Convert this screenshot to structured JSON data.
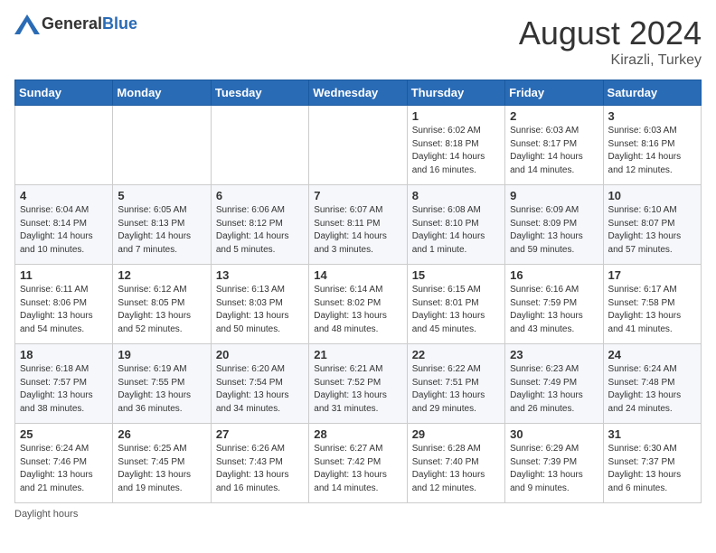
{
  "header": {
    "logo_general": "General",
    "logo_blue": "Blue",
    "month_year": "August 2024",
    "location": "Kirazli, Turkey"
  },
  "days_of_week": [
    "Sunday",
    "Monday",
    "Tuesday",
    "Wednesday",
    "Thursday",
    "Friday",
    "Saturday"
  ],
  "weeks": [
    [
      {
        "day": "",
        "info": ""
      },
      {
        "day": "",
        "info": ""
      },
      {
        "day": "",
        "info": ""
      },
      {
        "day": "",
        "info": ""
      },
      {
        "day": "1",
        "info": "Sunrise: 6:02 AM\nSunset: 8:18 PM\nDaylight: 14 hours\nand 16 minutes."
      },
      {
        "day": "2",
        "info": "Sunrise: 6:03 AM\nSunset: 8:17 PM\nDaylight: 14 hours\nand 14 minutes."
      },
      {
        "day": "3",
        "info": "Sunrise: 6:03 AM\nSunset: 8:16 PM\nDaylight: 14 hours\nand 12 minutes."
      }
    ],
    [
      {
        "day": "4",
        "info": "Sunrise: 6:04 AM\nSunset: 8:14 PM\nDaylight: 14 hours\nand 10 minutes."
      },
      {
        "day": "5",
        "info": "Sunrise: 6:05 AM\nSunset: 8:13 PM\nDaylight: 14 hours\nand 7 minutes."
      },
      {
        "day": "6",
        "info": "Sunrise: 6:06 AM\nSunset: 8:12 PM\nDaylight: 14 hours\nand 5 minutes."
      },
      {
        "day": "7",
        "info": "Sunrise: 6:07 AM\nSunset: 8:11 PM\nDaylight: 14 hours\nand 3 minutes."
      },
      {
        "day": "8",
        "info": "Sunrise: 6:08 AM\nSunset: 8:10 PM\nDaylight: 14 hours\nand 1 minute."
      },
      {
        "day": "9",
        "info": "Sunrise: 6:09 AM\nSunset: 8:09 PM\nDaylight: 13 hours\nand 59 minutes."
      },
      {
        "day": "10",
        "info": "Sunrise: 6:10 AM\nSunset: 8:07 PM\nDaylight: 13 hours\nand 57 minutes."
      }
    ],
    [
      {
        "day": "11",
        "info": "Sunrise: 6:11 AM\nSunset: 8:06 PM\nDaylight: 13 hours\nand 54 minutes."
      },
      {
        "day": "12",
        "info": "Sunrise: 6:12 AM\nSunset: 8:05 PM\nDaylight: 13 hours\nand 52 minutes."
      },
      {
        "day": "13",
        "info": "Sunrise: 6:13 AM\nSunset: 8:03 PM\nDaylight: 13 hours\nand 50 minutes."
      },
      {
        "day": "14",
        "info": "Sunrise: 6:14 AM\nSunset: 8:02 PM\nDaylight: 13 hours\nand 48 minutes."
      },
      {
        "day": "15",
        "info": "Sunrise: 6:15 AM\nSunset: 8:01 PM\nDaylight: 13 hours\nand 45 minutes."
      },
      {
        "day": "16",
        "info": "Sunrise: 6:16 AM\nSunset: 7:59 PM\nDaylight: 13 hours\nand 43 minutes."
      },
      {
        "day": "17",
        "info": "Sunrise: 6:17 AM\nSunset: 7:58 PM\nDaylight: 13 hours\nand 41 minutes."
      }
    ],
    [
      {
        "day": "18",
        "info": "Sunrise: 6:18 AM\nSunset: 7:57 PM\nDaylight: 13 hours\nand 38 minutes."
      },
      {
        "day": "19",
        "info": "Sunrise: 6:19 AM\nSunset: 7:55 PM\nDaylight: 13 hours\nand 36 minutes."
      },
      {
        "day": "20",
        "info": "Sunrise: 6:20 AM\nSunset: 7:54 PM\nDaylight: 13 hours\nand 34 minutes."
      },
      {
        "day": "21",
        "info": "Sunrise: 6:21 AM\nSunset: 7:52 PM\nDaylight: 13 hours\nand 31 minutes."
      },
      {
        "day": "22",
        "info": "Sunrise: 6:22 AM\nSunset: 7:51 PM\nDaylight: 13 hours\nand 29 minutes."
      },
      {
        "day": "23",
        "info": "Sunrise: 6:23 AM\nSunset: 7:49 PM\nDaylight: 13 hours\nand 26 minutes."
      },
      {
        "day": "24",
        "info": "Sunrise: 6:24 AM\nSunset: 7:48 PM\nDaylight: 13 hours\nand 24 minutes."
      }
    ],
    [
      {
        "day": "25",
        "info": "Sunrise: 6:24 AM\nSunset: 7:46 PM\nDaylight: 13 hours\nand 21 minutes."
      },
      {
        "day": "26",
        "info": "Sunrise: 6:25 AM\nSunset: 7:45 PM\nDaylight: 13 hours\nand 19 minutes."
      },
      {
        "day": "27",
        "info": "Sunrise: 6:26 AM\nSunset: 7:43 PM\nDaylight: 13 hours\nand 16 minutes."
      },
      {
        "day": "28",
        "info": "Sunrise: 6:27 AM\nSunset: 7:42 PM\nDaylight: 13 hours\nand 14 minutes."
      },
      {
        "day": "29",
        "info": "Sunrise: 6:28 AM\nSunset: 7:40 PM\nDaylight: 13 hours\nand 12 minutes."
      },
      {
        "day": "30",
        "info": "Sunrise: 6:29 AM\nSunset: 7:39 PM\nDaylight: 13 hours\nand 9 minutes."
      },
      {
        "day": "31",
        "info": "Sunrise: 6:30 AM\nSunset: 7:37 PM\nDaylight: 13 hours\nand 6 minutes."
      }
    ]
  ],
  "footer": {
    "note": "Daylight hours"
  }
}
